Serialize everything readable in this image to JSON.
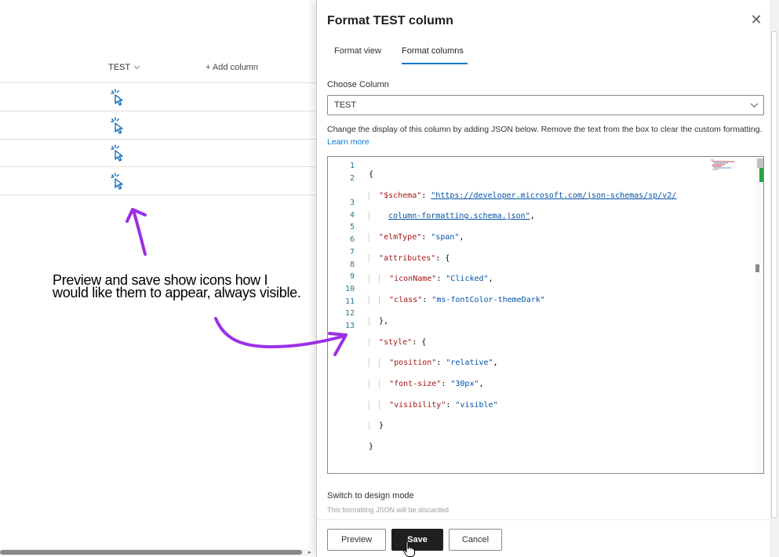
{
  "list": {
    "columns": [
      {
        "label": "TEST"
      },
      {
        "label": "+ Add column"
      }
    ],
    "rows": [
      {
        "icon": "clicked-icon"
      },
      {
        "icon": "clicked-icon"
      },
      {
        "icon": "clicked-icon"
      },
      {
        "icon": "clicked-icon"
      }
    ]
  },
  "annotation": {
    "text": "Preview and save show icons how I would like them to appear, always visible."
  },
  "panel": {
    "title": "Format TEST column",
    "tabs": [
      {
        "label": "Format view"
      },
      {
        "label": "Format columns",
        "active": true
      }
    ],
    "choose_column_label": "Choose Column",
    "choose_column_value": "TEST",
    "description": "Change the display of this column by adding JSON below. Remove the text from the box to clear the custom formatting.",
    "learn_more": "Learn more",
    "editor": {
      "line_numbers": [
        "1",
        "2",
        "",
        "3",
        "4",
        "5",
        "6",
        "7",
        "8",
        "9",
        "10",
        "11",
        "12",
        "13"
      ],
      "schema_key": "\"$schema\"",
      "schema_url_1": "\"https://developer.microsoft.com/json-schemas/sp/v2/",
      "schema_url_2": "column-formatting.schema.json\"",
      "elm_type_key": "\"elmType\"",
      "elm_type_value": "\"span\"",
      "attributes_key": "\"attributes\"",
      "icon_name_key": "\"iconName\"",
      "icon_name_value": "\"Clicked\"",
      "class_key": "\"class\"",
      "class_value": "\"ms-fontColor-themeDark\"",
      "style_key": "\"style\"",
      "position_key": "\"position\"",
      "position_value": "\"relative\"",
      "font_size_key": "\"font-size\"",
      "font_size_value": "\"30px\"",
      "visibility_key": "\"visibility\"",
      "visibility_value": "\"visible\""
    },
    "switch_design_mode": "Switch to design mode",
    "discard_note": "This formatting JSON will be discarded",
    "buttons": {
      "preview": "Preview",
      "save": "Save",
      "cancel": "Cancel"
    }
  },
  "colors": {
    "accent": "#0078d4",
    "annotation_arrow": "#9b30e6",
    "icon": "#0f6cbd"
  }
}
